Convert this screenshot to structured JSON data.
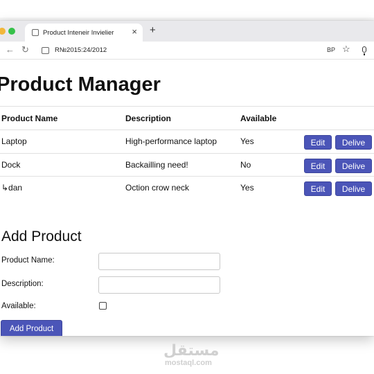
{
  "browser": {
    "tab_title": "Product Inteneir Invielier",
    "tab_close": "×",
    "new_tab": "+",
    "address": "R№2015:24/2012",
    "toolbar_right_text": "BP"
  },
  "page": {
    "title": "Product Manager"
  },
  "table": {
    "headers": [
      "Product Name",
      "Description",
      "Available"
    ],
    "rows": [
      {
        "name": "Laptop",
        "description": "High-performance laptop",
        "available": "Yes",
        "edit_label": "Edit",
        "delete_label": "Delive"
      },
      {
        "name": "Dock",
        "description": "Backailling need!",
        "available": "No",
        "edit_label": "Edit",
        "delete_label": "Delive"
      },
      {
        "name": "↳dan",
        "description": "Oction crow neck",
        "available": "Yes",
        "edit_label": "Edit",
        "delete_label": "Delive"
      }
    ]
  },
  "form": {
    "title": "Add Product",
    "name_label": "Product Name:",
    "name_value": "",
    "description_label": "Description:",
    "description_value": "",
    "available_label": "Available:",
    "available_checked": false,
    "submit_label": "Add Product"
  },
  "watermark": {
    "arabic": "مستقل",
    "latin": "mostaql.com"
  },
  "colors": {
    "button": "#4b55b8",
    "traffic_yellow": "#f2b73a",
    "traffic_green": "#36c14a"
  },
  "icons": {
    "back": "arrow-left-icon",
    "reload": "reload-icon",
    "bookmark": "star-icon",
    "mic": "microphone-icon"
  }
}
